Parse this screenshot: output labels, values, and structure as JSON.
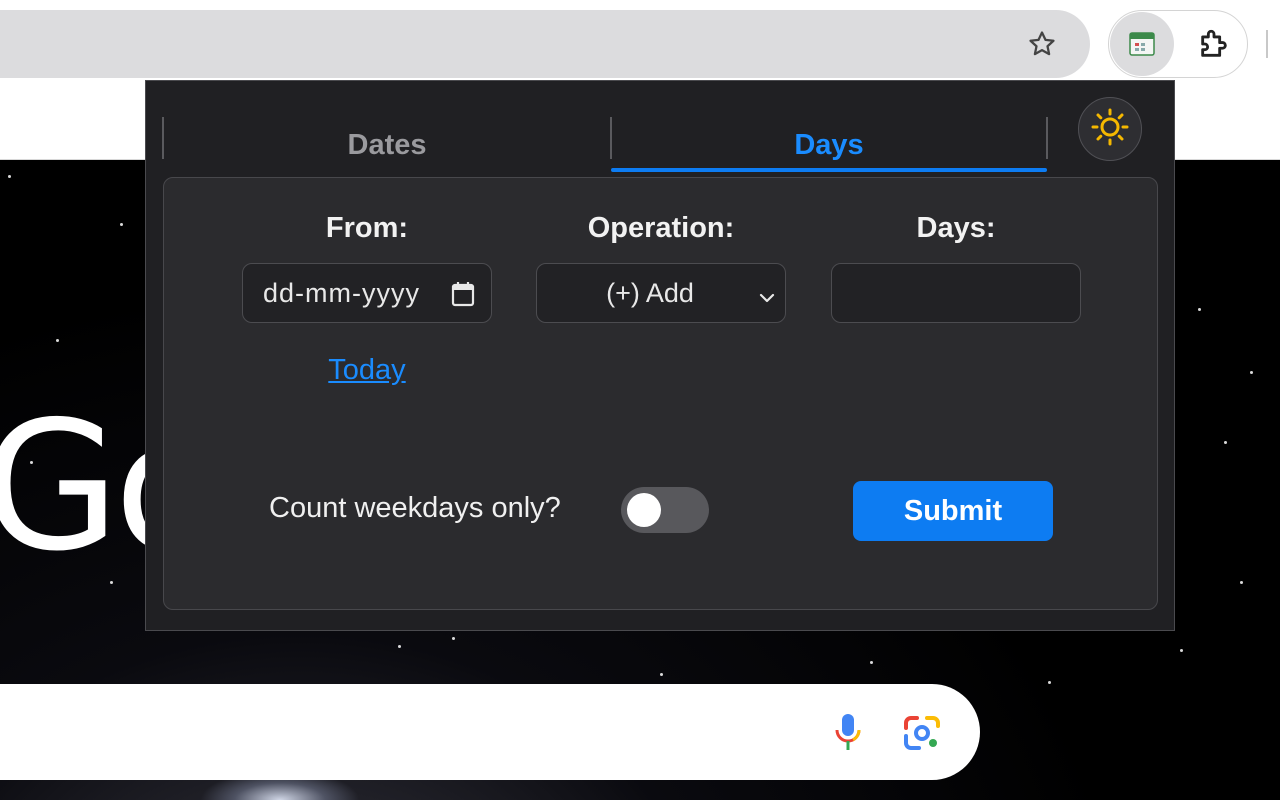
{
  "browser": {
    "toolbar_icons": [
      "star-icon",
      "extension-app-icon",
      "puzzle-icon"
    ]
  },
  "background_page": {
    "logo_text": "Go",
    "icons": [
      "mic-icon",
      "lens-icon"
    ]
  },
  "popup": {
    "tabs": [
      {
        "label": "Dates",
        "active": false
      },
      {
        "label": "Days",
        "active": true
      }
    ],
    "theme_toggle_icon": "sun-icon",
    "accent_color": "#0d7cf2",
    "form": {
      "from": {
        "label": "From:",
        "placeholder": "dd-mm-yyyy"
      },
      "operation": {
        "label": "Operation:",
        "selected": "(+) Add"
      },
      "days": {
        "label": "Days:",
        "value": ""
      },
      "today_link": "Today",
      "weekdays": {
        "label": "Count weekdays only?",
        "checked": false
      },
      "submit_label": "Submit"
    }
  }
}
